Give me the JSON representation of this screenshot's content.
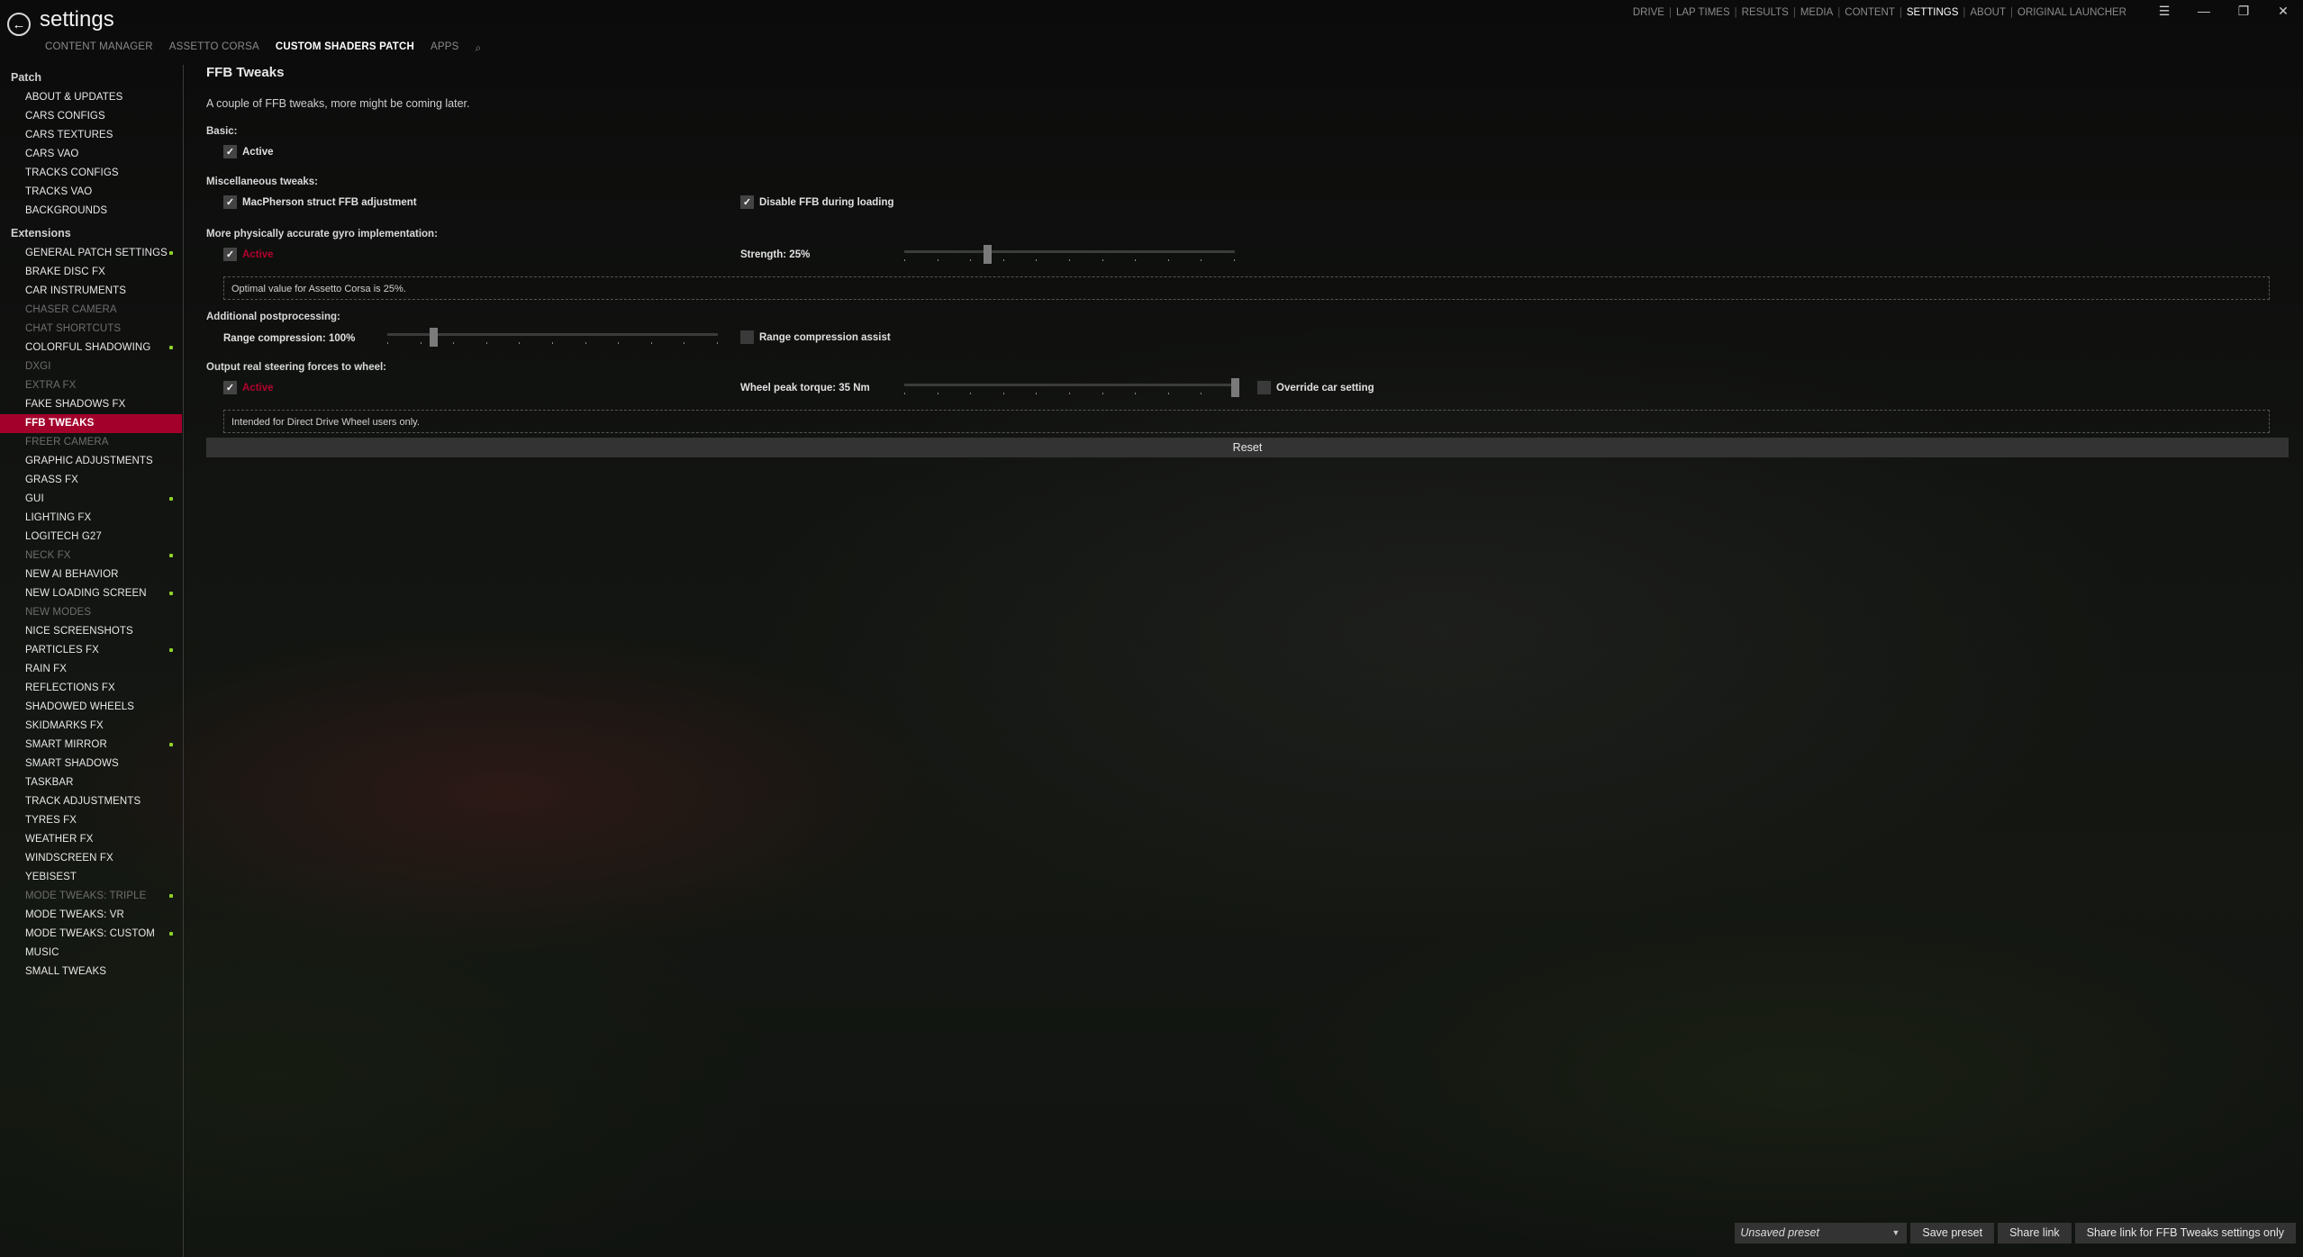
{
  "window": {
    "title": "settings",
    "back_icon": "arrow-left-circle-icon",
    "sub_tabs": [
      {
        "label": "CONTENT MANAGER",
        "active": false
      },
      {
        "label": "ASSETTO CORSA",
        "active": false
      },
      {
        "label": "CUSTOM SHADERS PATCH",
        "active": true
      },
      {
        "label": "APPS",
        "active": false
      }
    ],
    "search_icon": "⌕",
    "top_nav": [
      {
        "label": "DRIVE",
        "active": false
      },
      {
        "label": "LAP TIMES",
        "active": false
      },
      {
        "label": "RESULTS",
        "active": false
      },
      {
        "label": "MEDIA",
        "active": false
      },
      {
        "label": "CONTENT",
        "active": false
      },
      {
        "label": "SETTINGS",
        "active": true
      },
      {
        "label": "ABOUT",
        "active": false
      },
      {
        "label": "ORIGINAL LAUNCHER",
        "active": false
      }
    ],
    "controls": {
      "menu": "☰",
      "minimize": "—",
      "restore": "❐",
      "close": "✕"
    }
  },
  "sidebar": {
    "groups": [
      {
        "header": "Patch",
        "items": [
          {
            "label": "ABOUT & UPDATES"
          },
          {
            "label": "CARS CONFIGS"
          },
          {
            "label": "CARS TEXTURES"
          },
          {
            "label": "CARS VAO"
          },
          {
            "label": "TRACKS CONFIGS"
          },
          {
            "label": "TRACKS VAO"
          },
          {
            "label": "BACKGROUNDS"
          }
        ]
      },
      {
        "header": "Extensions",
        "items": [
          {
            "label": "GENERAL PATCH SETTINGS",
            "dot": true
          },
          {
            "label": "BRAKE DISC FX"
          },
          {
            "label": "CAR INSTRUMENTS"
          },
          {
            "label": "CHASER CAMERA",
            "disabled": true
          },
          {
            "label": "CHAT SHORTCUTS",
            "disabled": true
          },
          {
            "label": "COLORFUL SHADOWING",
            "dot": true
          },
          {
            "label": "DXGI",
            "disabled": true
          },
          {
            "label": "EXTRA FX",
            "disabled": true
          },
          {
            "label": "FAKE SHADOWS FX"
          },
          {
            "label": "FFB TWEAKS",
            "selected": true
          },
          {
            "label": "FREER CAMERA",
            "disabled": true
          },
          {
            "label": "GRAPHIC ADJUSTMENTS"
          },
          {
            "label": "GRASS FX"
          },
          {
            "label": "GUI",
            "dot": true
          },
          {
            "label": "LIGHTING FX"
          },
          {
            "label": "LOGITECH G27"
          },
          {
            "label": "NECK FX",
            "disabled": true,
            "dot": true
          },
          {
            "label": "NEW AI BEHAVIOR"
          },
          {
            "label": "NEW LOADING SCREEN",
            "dot": true
          },
          {
            "label": "NEW MODES",
            "disabled": true
          },
          {
            "label": "NICE SCREENSHOTS"
          },
          {
            "label": "PARTICLES FX",
            "dot": true
          },
          {
            "label": "RAIN FX"
          },
          {
            "label": "REFLECTIONS FX"
          },
          {
            "label": "SHADOWED WHEELS"
          },
          {
            "label": "SKIDMARKS FX"
          },
          {
            "label": "SMART MIRROR",
            "dot": true
          },
          {
            "label": "SMART SHADOWS"
          },
          {
            "label": "TASKBAR"
          },
          {
            "label": "TRACK ADJUSTMENTS"
          },
          {
            "label": "TYRES FX"
          },
          {
            "label": "WEATHER FX"
          },
          {
            "label": "WINDSCREEN FX"
          },
          {
            "label": "YEBISEST"
          },
          {
            "label": "MODE TWEAKS: TRIPLE",
            "disabled": true,
            "dot": true
          },
          {
            "label": "MODE TWEAKS: VR"
          },
          {
            "label": "MODE TWEAKS: CUSTOM",
            "dot": true
          },
          {
            "label": "MUSIC"
          },
          {
            "label": "SMALL TWEAKS"
          }
        ]
      }
    ]
  },
  "main": {
    "title": "FFB Tweaks",
    "description": "A couple of FFB tweaks, more might be coming later.",
    "basic": {
      "label": "Basic:",
      "active": {
        "label": "Active",
        "checked": true
      }
    },
    "misc": {
      "label": "Miscellaneous tweaks:",
      "macpherson": {
        "label": "MacPherson struct FFB adjustment",
        "checked": true
      },
      "disable_loading": {
        "label": "Disable FFB during loading",
        "checked": true
      }
    },
    "gyro": {
      "label": "More physically accurate gyro implementation:",
      "active": {
        "label": "Active",
        "checked": true
      },
      "strength": {
        "label": "Strength: 25%",
        "value_fraction": 0.25
      },
      "note": "Optimal value for Assetto Corsa is 25%."
    },
    "postprocessing": {
      "label": "Additional postprocessing:",
      "range_compression": {
        "label": "Range compression: 100%",
        "value_fraction": 0.14
      },
      "assist": {
        "label": "Range compression assist",
        "checked": false
      }
    },
    "steering": {
      "label": "Output real steering forces to wheel:",
      "active": {
        "label": "Active",
        "checked": true
      },
      "torque": {
        "label": "Wheel peak torque: 35 Nm",
        "value_fraction": 1.0
      },
      "override": {
        "label": "Override car setting",
        "checked": false
      },
      "note": "Intended for Direct Drive Wheel users only."
    },
    "reset_label": "Reset"
  },
  "footer": {
    "preset": "Unsaved preset",
    "dropdown_arrow": "▼",
    "save_preset": "Save preset",
    "share_link": "Share link",
    "share_link_only": "Share link for FFB Tweaks settings only"
  },
  "colors": {
    "accent": "#a3002c",
    "active_red_text": "#b3002d",
    "modified_dot": "#8fd12a"
  }
}
